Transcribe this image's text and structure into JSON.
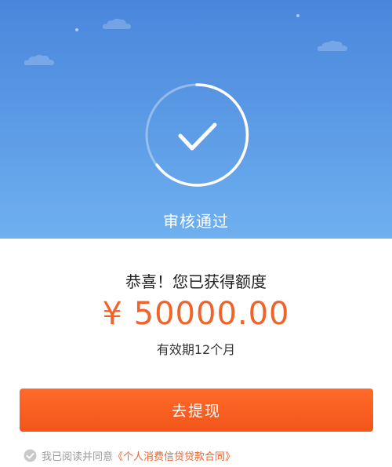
{
  "hero": {
    "status_text": "审核通过",
    "status_icon": "check-circle-icon"
  },
  "result": {
    "congrats_text": "恭喜！您已获得额度",
    "amount": "¥ 50000.00",
    "validity": "有效期12个月"
  },
  "action": {
    "withdraw_label": "去提现"
  },
  "agreement": {
    "checkbox_icon": "check-icon",
    "prefix": "我已阅读并同意",
    "link_text": "《个人消费信贷贷款合同》"
  },
  "colors": {
    "accent": "#f0632a",
    "hero_top": "#4a86dc",
    "hero_bottom": "#6fb0f0"
  }
}
